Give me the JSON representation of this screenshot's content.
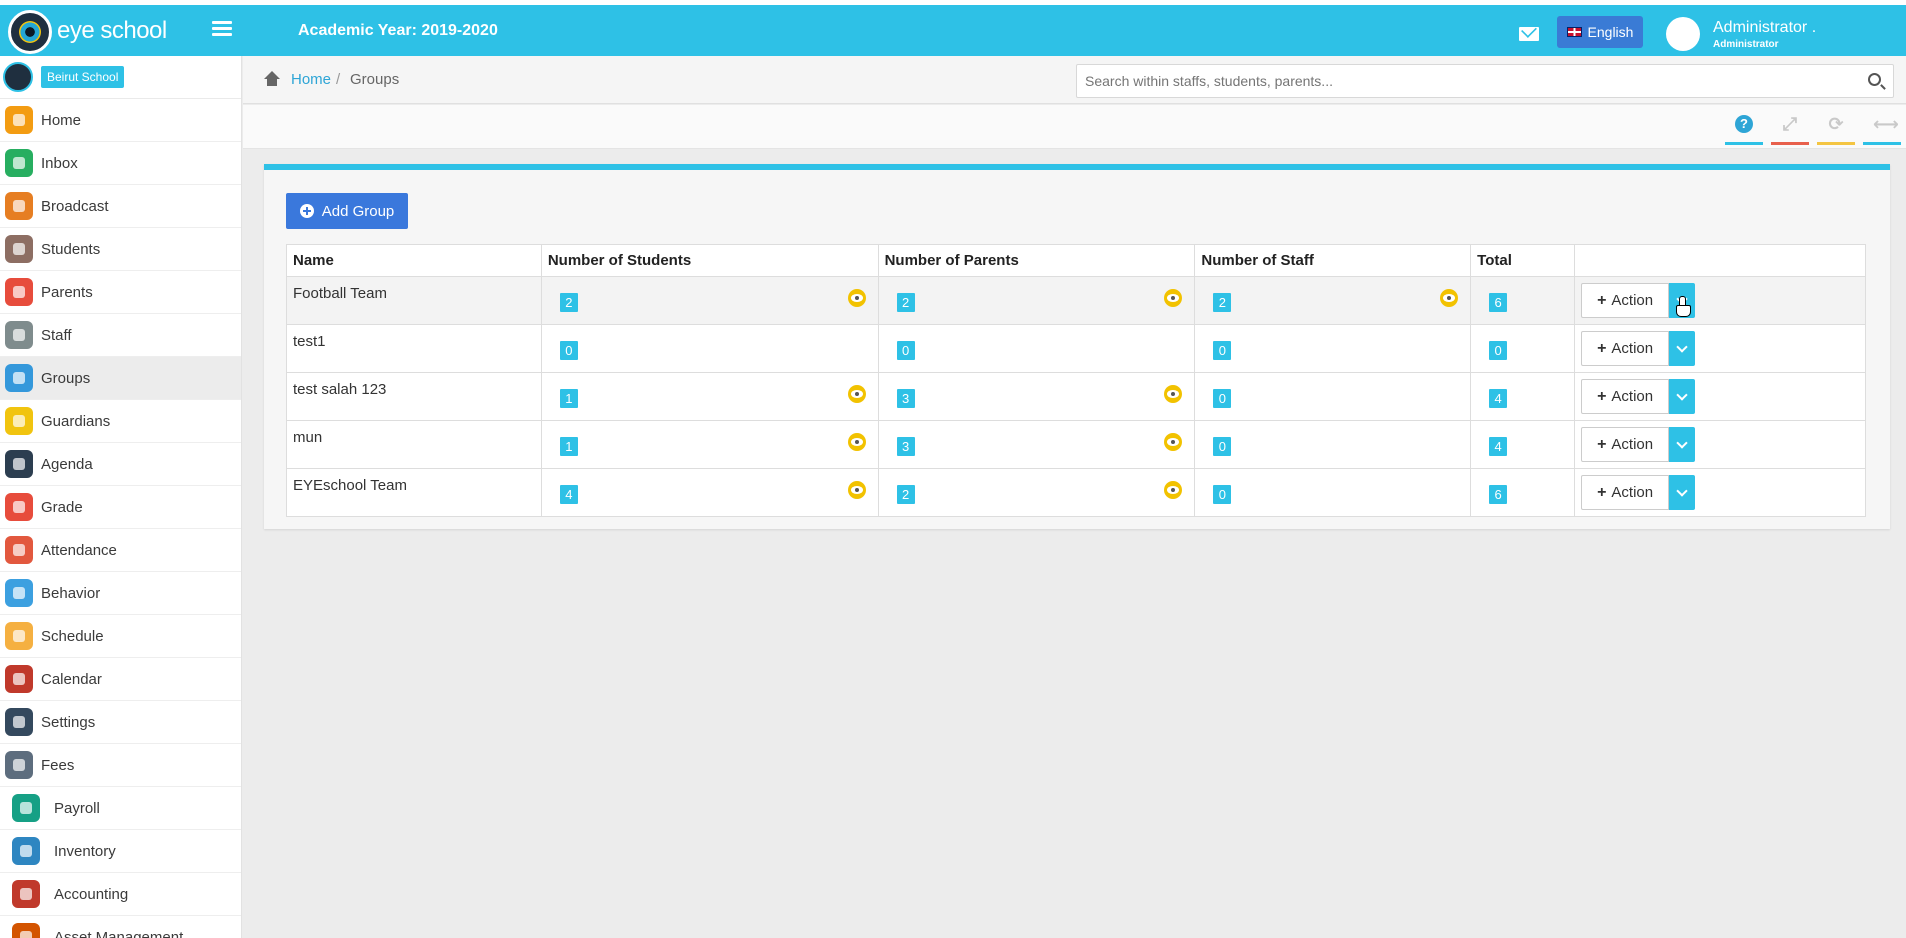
{
  "header": {
    "brand": "eye school",
    "academic_year": "Academic Year: 2019-2020",
    "language_label": "English",
    "user_name": "Administrator .",
    "user_role": "Administrator"
  },
  "sidebar": {
    "school_name": "Beirut School",
    "active_item": "Groups",
    "items": [
      {
        "label": "Home",
        "icon": "home-icon",
        "color": "#f39c12"
      },
      {
        "label": "Inbox",
        "icon": "inbox-icon",
        "color": "#27ae60"
      },
      {
        "label": "Broadcast",
        "icon": "broadcast-icon",
        "color": "#e67e22"
      },
      {
        "label": "Students",
        "icon": "students-icon",
        "color": "#8d6e63"
      },
      {
        "label": "Parents",
        "icon": "parents-icon",
        "color": "#e74c3c"
      },
      {
        "label": "Staff",
        "icon": "staff-icon",
        "color": "#7f8c8d"
      },
      {
        "label": "Groups",
        "icon": "groups-icon",
        "color": "#3498db"
      },
      {
        "label": "Guardians",
        "icon": "guardians-icon",
        "color": "#f1c40f"
      },
      {
        "label": "Agenda",
        "icon": "agenda-icon",
        "color": "#2c3e50"
      },
      {
        "label": "Grade",
        "icon": "grade-icon",
        "color": "#e74c3c"
      },
      {
        "label": "Attendance",
        "icon": "attendance-icon",
        "color": "#e2583e"
      },
      {
        "label": "Behavior",
        "icon": "behavior-icon",
        "color": "#3ca0e0"
      },
      {
        "label": "Schedule",
        "icon": "schedule-icon",
        "color": "#f5b041"
      },
      {
        "label": "Calendar",
        "icon": "calendar-icon",
        "color": "#c0392b"
      },
      {
        "label": "Settings",
        "icon": "settings-icon",
        "color": "#34495e"
      },
      {
        "label": "Fees",
        "icon": "fees-icon",
        "color": "#5d6d7e"
      },
      {
        "label": "Payroll",
        "icon": "payroll-icon",
        "color": "#16a085"
      },
      {
        "label": "Inventory",
        "icon": "inventory-icon",
        "color": "#2e86c1"
      },
      {
        "label": "Accounting",
        "icon": "accounting-icon",
        "color": "#c0392b"
      },
      {
        "label": "Asset Management",
        "icon": "asset-management-icon",
        "color": "#d35400"
      }
    ]
  },
  "breadcrumb": {
    "home": "Home",
    "separator": "/",
    "current": "Groups"
  },
  "search": {
    "value": "",
    "placeholder": "Search within staffs, students, parents..."
  },
  "toolbar": {
    "tools": [
      {
        "name": "help-icon",
        "glyph": "?",
        "color": "#2ea5d6",
        "bar_color": "#2ec1e6"
      },
      {
        "name": "fullscreen-icon",
        "glyph": "⤢",
        "color": "#c9c9c9",
        "bar_color": "#e8604c"
      },
      {
        "name": "refresh-icon",
        "glyph": "⟳",
        "color": "#c9c9c9",
        "bar_color": "#f4c542"
      },
      {
        "name": "collapse-icon",
        "glyph": "⟷",
        "color": "#c9c9c9",
        "bar_color": "#2ec1e6"
      }
    ]
  },
  "main": {
    "add_button_label": "Add Group",
    "table": {
      "headers": [
        "Name",
        "Number of Students",
        "Number of Parents",
        "Number of Staff",
        "Total",
        ""
      ],
      "rows": [
        {
          "name": "Football Team",
          "students": "2",
          "parents": "2",
          "staff": "2",
          "total": "6",
          "eye_students": true,
          "eye_parents": true,
          "eye_staff": true
        },
        {
          "name": "test1",
          "students": "0",
          "parents": "0",
          "staff": "0",
          "total": "0",
          "eye_students": false,
          "eye_parents": false,
          "eye_staff": false
        },
        {
          "name": "test salah 123",
          "students": "1",
          "parents": "3",
          "staff": "0",
          "total": "4",
          "eye_students": true,
          "eye_parents": true,
          "eye_staff": false
        },
        {
          "name": "mun",
          "students": "1",
          "parents": "3",
          "staff": "0",
          "total": "4",
          "eye_students": true,
          "eye_parents": true,
          "eye_staff": false
        },
        {
          "name": "EYEschool Team",
          "students": "4",
          "parents": "2",
          "staff": "0",
          "total": "6",
          "eye_students": true,
          "eye_parents": true,
          "eye_staff": false
        }
      ],
      "action_label": "Action"
    }
  },
  "colors": {
    "accent": "#2ec1e6",
    "primary_button": "#3a78dc",
    "eye_badge": "#f2c200"
  }
}
